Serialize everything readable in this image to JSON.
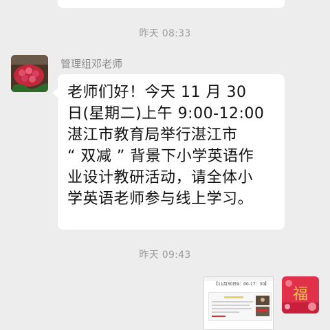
{
  "timestamps": [
    "昨天 08:33",
    "昨天 09:43"
  ],
  "sender": {
    "name": "管理组邓老师",
    "avatar_icon": "rose-bouquet-avatar"
  },
  "message": {
    "lines": [
      "老师们好！今天 11 月 30",
      "日(星期二)上午 9:00-12:00",
      "湛江市教育局举行湛江市",
      "“ 双减 ” 背景下小学英语作",
      "业设计教研活动，请全体小",
      "学英语老师参与线上学习。"
    ]
  },
  "outgoing": {
    "screenshot_title": "【11月30日9：00-17：30】",
    "avatar_icon": "fu-character-avatar",
    "colors": {
      "avatar_bg": "#e0304a"
    }
  }
}
